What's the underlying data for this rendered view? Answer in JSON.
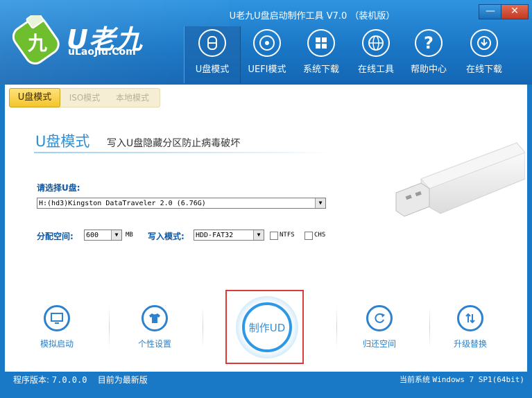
{
  "window": {
    "title": "U老九U盘启动制作工具 V7.0 （装机版）",
    "minimize_glyph": "—",
    "close_glyph": "✕"
  },
  "logo": {
    "text": "U老九",
    "url": "uLaoJiu.Com",
    "icon": "usb-drive-green-icon"
  },
  "nav": [
    {
      "label": "U盘模式",
      "icon": "usb-disk-icon",
      "active": true
    },
    {
      "label": "UEFI模式",
      "icon": "cd-disc-icon",
      "active": false
    },
    {
      "label": "系统下载",
      "icon": "windows-logo-icon",
      "active": false
    },
    {
      "label": "在线工具",
      "icon": "globe-icon",
      "active": false
    },
    {
      "label": "帮助中心",
      "icon": "question-icon",
      "active": false
    },
    {
      "label": "在线下载",
      "icon": "download-icon",
      "active": false
    }
  ],
  "tabs": [
    "U盘模式",
    "ISO模式",
    "本地模式"
  ],
  "section": {
    "title": "U盘模式",
    "subtitle": "写入U盘隐藏分区防止病毒破坏"
  },
  "form": {
    "choose_label": "请选择U盘:",
    "disk_value": "H:(hd3)Kingston DataTraveler 2.0 (6.76G)",
    "alloc_label": "分配空间:",
    "alloc_value": "600",
    "alloc_unit": "MB",
    "write_label": "写入模式:",
    "write_value": "HDD-FAT32",
    "ntfs_label": "NTFS",
    "chs_label": "CHS",
    "ntfs_checked": false,
    "chs_checked": false
  },
  "actions": {
    "simulate": "模拟启动",
    "personalize": "个性设置",
    "make": "制作UD",
    "restore": "归还空间",
    "upgrade": "升级替换"
  },
  "status": {
    "version_label": "程序版本:",
    "version": "7.0.0.0",
    "update_note": "目前为最新版",
    "system_label": "当前系统",
    "system": "Windows 7 SP1(64bit)"
  },
  "colors": {
    "header_blue": "#1a79c7",
    "accent_blue": "#2b8fd8",
    "tab_yellow": "#f3c42c",
    "highlight_red": "#d93a3a"
  }
}
